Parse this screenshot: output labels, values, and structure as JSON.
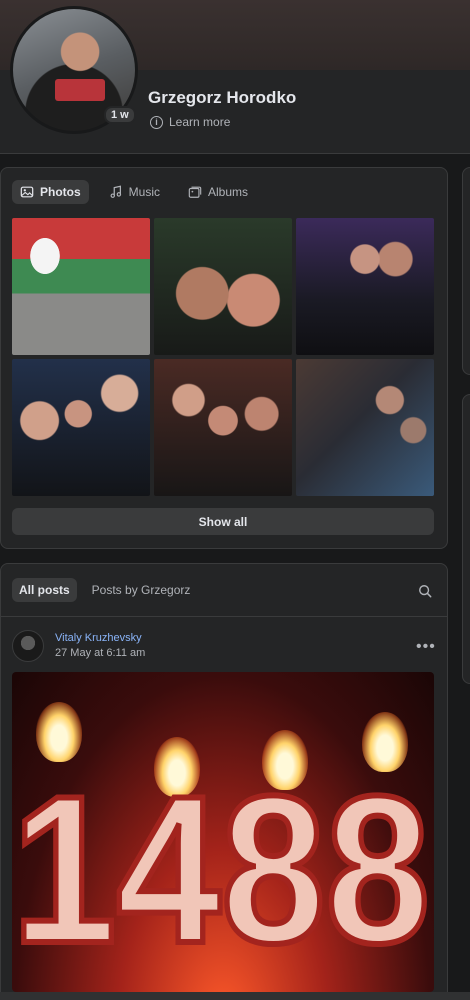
{
  "profile": {
    "name": "Grzegorz Horodko",
    "presence_badge": "1 w",
    "learn_more": "Learn more"
  },
  "photos_section": {
    "tabs": [
      {
        "label": "Photos",
        "icon": "photo-icon",
        "active": true
      },
      {
        "label": "Music",
        "icon": "music-note-icon",
        "active": false
      },
      {
        "label": "Albums",
        "icon": "albums-icon",
        "active": false
      }
    ],
    "show_all": "Show all"
  },
  "posts_section": {
    "tabs": [
      {
        "label": "All posts",
        "active": true
      },
      {
        "label": "Posts by Grzegorz",
        "active": false
      }
    ],
    "post": {
      "author": "Vitaly Kruzhevsky",
      "date": "27 May at 6:11 am",
      "image_text": "1488"
    }
  },
  "colors": {
    "background": "#18191a",
    "surface": "#242526",
    "link": "#8ab4f8",
    "muted": "#b0b3b8"
  }
}
